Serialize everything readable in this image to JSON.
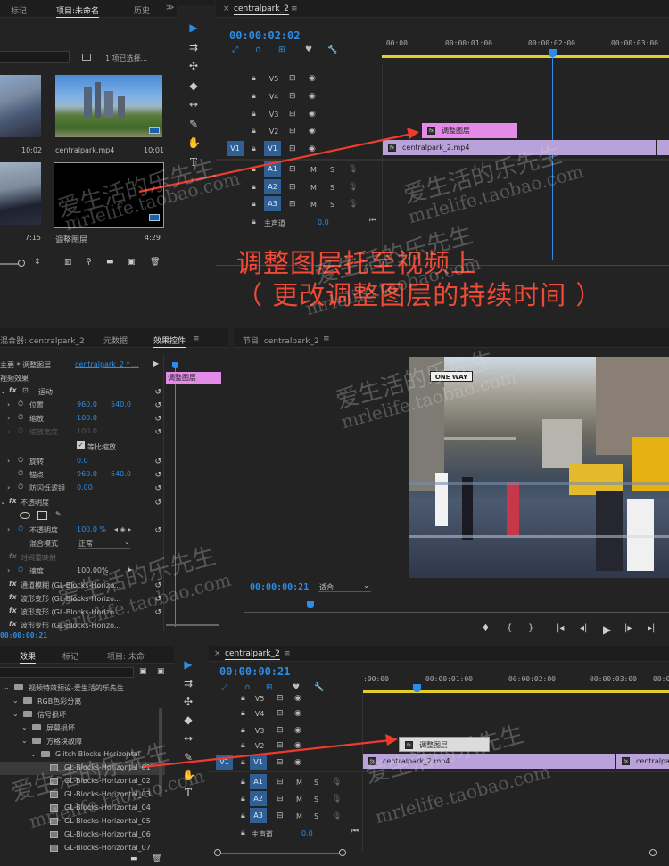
{
  "top_project": {
    "tabs": [
      "标记",
      "项目:未命名",
      "历史"
    ],
    "menu_icon": "menu-icon",
    "selection_text": "1 项已选择...",
    "items": [
      {
        "name": "centralpark.mp4",
        "duration": "10:01"
      },
      {
        "name": "",
        "duration": "10:02"
      },
      {
        "name": "",
        "duration": "7:15"
      },
      {
        "name": "调整图层",
        "duration": "4:29"
      }
    ]
  },
  "top_timeline": {
    "tab": "centralpark_2",
    "timecode": "00:00:02:02",
    "ruler": [
      ":00:00",
      "00:00:01:00",
      "00:00:02:00",
      "00:00:03:00"
    ],
    "tracks_video": [
      "V5",
      "V4",
      "V3",
      "V2",
      "V1"
    ],
    "tracks_audio": [
      "A1",
      "A2",
      "A3"
    ],
    "source_patch": "V1",
    "audio_labels": {
      "m": "M",
      "s": "S"
    },
    "master_label": "主声道",
    "master_value": "0.0",
    "clip_adjust": "调整图层",
    "clip_video": "centralpark_2.mp4"
  },
  "caption": {
    "line1": "调整图层托至视频上",
    "line2": "（ 更改调整图层的持续时间 ）"
  },
  "effect_controls": {
    "tabs": [
      "混合器: centralpark_2",
      "元数据",
      "效果控件"
    ],
    "header_master": "主要 * 调整图层",
    "header_seq": "centralpark_2 * ...",
    "section_video": "视频效果",
    "motion": "运动",
    "position_label": "位置",
    "position_x": "960.0",
    "position_y": "540.0",
    "scale_label": "缩放",
    "scale_value": "100.0",
    "scale_width_label": "缩放宽度",
    "scale_width_value": "100.0",
    "uniform_scale": "等比缩放",
    "rotation_label": "旋转",
    "rotation_value": "0.0",
    "anchor_label": "锚点",
    "anchor_x": "960.0",
    "anchor_y": "540.0",
    "flicker_label": "防闪烁滤镜",
    "flicker_value": "0.00",
    "opacity_section": "不透明度",
    "opacity_label": "不透明度",
    "opacity_value": "100.0 %",
    "blend_label": "混合模式",
    "blend_value": "正常",
    "time_remap": "时间重映射",
    "speed_label": "速度",
    "speed_value": "100.00%",
    "effects": [
      "通道模糊 (GL-Blocks-Horizo...",
      "波形变形 (GL-Blocks-Horizo...",
      "波形变形 (GL-Blocks-Horizo...",
      "波形变形 (GL-Blocks-Horizo..."
    ],
    "mini_clip": "调整图层",
    "footer_time": "00:00:00:21"
  },
  "program_monitor": {
    "tab_label": "节目: centralpark_2",
    "timecode": "00:00:00:21",
    "fit_label": "适合",
    "sign_text": "ONE WAY"
  },
  "effects_panel": {
    "tabs": [
      "效果",
      "标记",
      "项目: 未命"
    ],
    "tree": [
      {
        "indent": 0,
        "kind": "folder",
        "label": "视频特效预设-爱生活的乐先生"
      },
      {
        "indent": 1,
        "kind": "folder",
        "label": "RGB色彩分离"
      },
      {
        "indent": 1,
        "kind": "folder",
        "label": "信号损坏"
      },
      {
        "indent": 2,
        "kind": "folder",
        "label": "屏幕损坏"
      },
      {
        "indent": 2,
        "kind": "folder",
        "label": "方格块故障"
      },
      {
        "indent": 3,
        "kind": "folder",
        "label": "Glitch Blocks Horizontal"
      },
      {
        "indent": 4,
        "kind": "preset",
        "label": "GL-Blocks-Horizontal_01"
      },
      {
        "indent": 4,
        "kind": "preset",
        "label": "GL-Blocks-Horizontal_02"
      },
      {
        "indent": 4,
        "kind": "preset",
        "label": "GL-Blocks-Horizontal_03"
      },
      {
        "indent": 4,
        "kind": "preset",
        "label": "GL-Blocks-Horizontal_04"
      },
      {
        "indent": 4,
        "kind": "preset",
        "label": "GL-Blocks-Horizontal_05"
      },
      {
        "indent": 4,
        "kind": "preset",
        "label": "GL-Blocks-Horizontal_06"
      },
      {
        "indent": 4,
        "kind": "preset",
        "label": "GL-Blocks-Horizontal_07"
      }
    ]
  },
  "bottom_timeline": {
    "tab": "centralpark_2",
    "timecode": "00:00:00:21",
    "ruler": [
      ":00:00",
      "00:00:01:00",
      "00:00:02:00",
      "00:00:03:00",
      "00:0"
    ],
    "tracks_video": [
      "V5",
      "V4",
      "V3",
      "V2",
      "V1"
    ],
    "tracks_audio": [
      "A1",
      "A2",
      "A3"
    ],
    "source_patch": "V1",
    "audio_labels": {
      "m": "M",
      "s": "S"
    },
    "master_label": "主声道",
    "master_value": "0.0",
    "clip_adjust": "调整图层",
    "clip_video": "centralpark_2.mp4",
    "clip_video2": "centralpark"
  },
  "watermark": {
    "cn": "爱生活的乐先生",
    "url": "mrlelife.taobao.com"
  },
  "colors": {
    "caption": "#f04a36",
    "timecode": "#2b8ce6",
    "clip_video": "#b9a1d9",
    "clip_adjust": "#e38be6",
    "arrow": "#ee3b2e"
  }
}
